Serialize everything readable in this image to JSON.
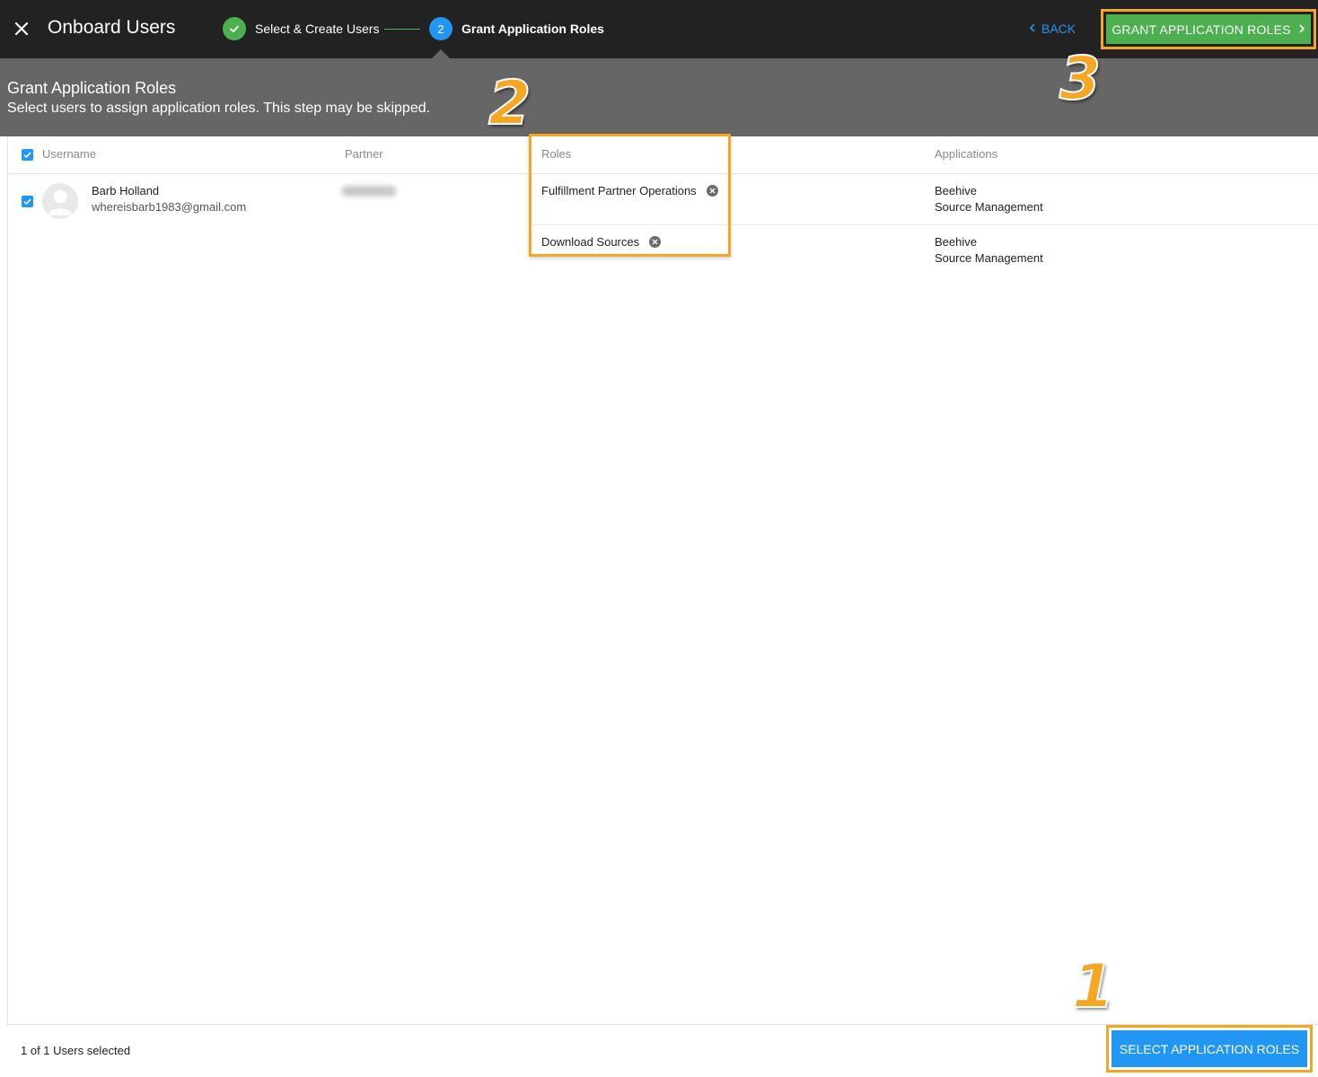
{
  "topbar": {
    "title": "Onboard Users",
    "steps": [
      {
        "label": "Select & Create Users",
        "status": "complete"
      },
      {
        "number": "2",
        "label": "Grant Application Roles",
        "status": "active"
      }
    ],
    "back_label": "BACK",
    "grant_label": "GRANT APPLICATION ROLES"
  },
  "header": {
    "title": "Grant Application Roles",
    "subtitle": "Select users to assign application roles. This step may be skipped."
  },
  "table": {
    "columns": [
      "Username",
      "Partner",
      "Roles",
      "Applications"
    ],
    "rows": [
      {
        "name": "Barb Holland",
        "email": "whereisbarb1983@gmail.com",
        "roles": [
          "Fulfillment Partner Operations",
          "Download Sources"
        ],
        "applications": [
          [
            "Beehive",
            "Source Management"
          ],
          [
            "Beehive",
            "Source Management"
          ]
        ]
      }
    ]
  },
  "footer": {
    "selected_text": "1 of 1 Users selected",
    "select_label": "SELECT APPLICATION ROLES"
  },
  "annotations": [
    "1",
    "2",
    "3"
  ],
  "colors": {
    "topbar": "#222222",
    "header_band": "#666666",
    "green": "#4caf50",
    "blue": "#2196f3",
    "highlight": "#f5a623"
  }
}
